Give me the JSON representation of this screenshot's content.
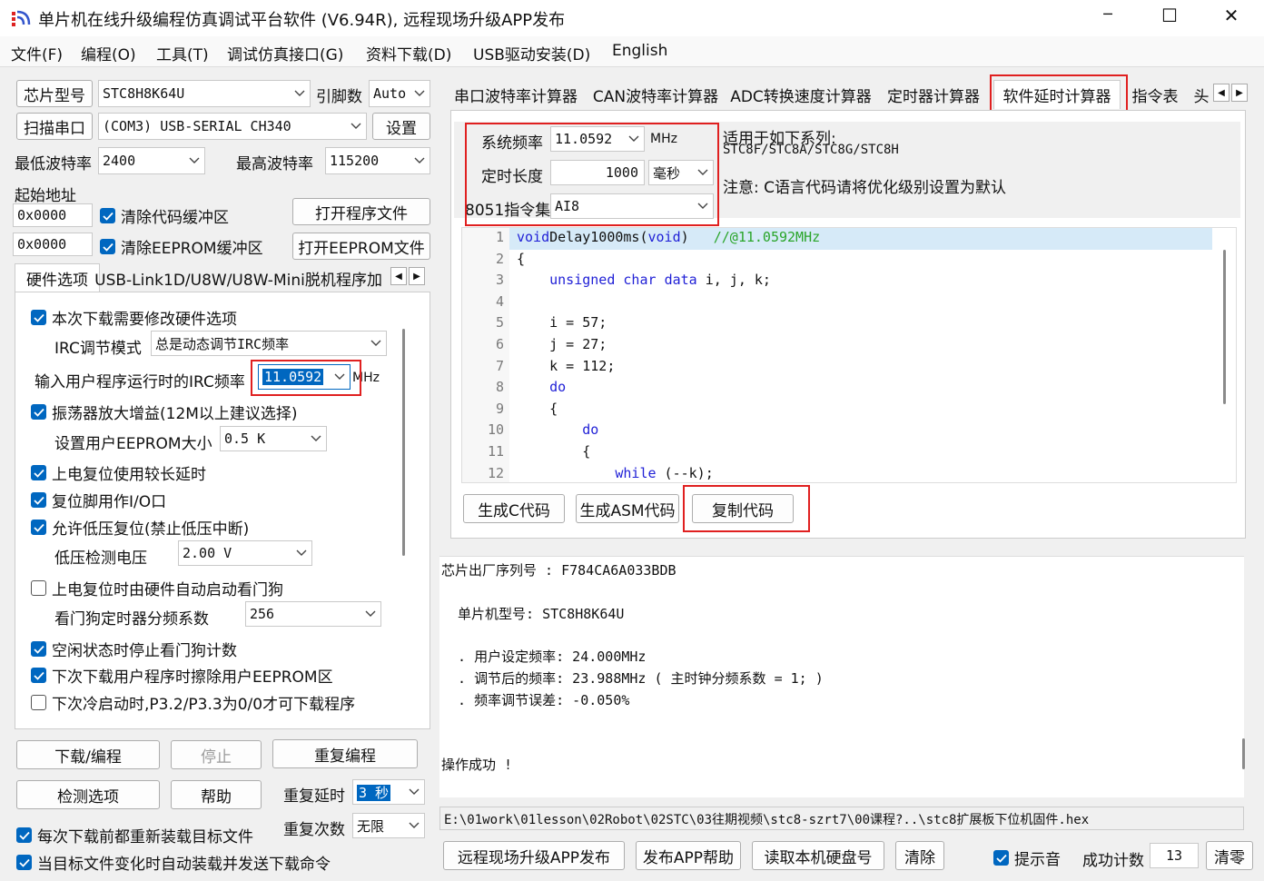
{
  "window": {
    "title": "单片机在线升级编程仿真调试平台软件 (V6.94R), 远程现场升级APP发布",
    "minimize": "─",
    "maximize": "☐",
    "close": "✕"
  },
  "menu": [
    "文件(F)",
    "编程(O)",
    "工具(T)",
    "调试仿真接口(G)",
    "资料下载(D)",
    "USB驱动安装(D)",
    "English"
  ],
  "left": {
    "chip_btn": "芯片型号",
    "chip_value": "STC8H8K64U",
    "pins_label": "引脚数",
    "pins_value": "Auto",
    "scan_btn": "扫描串口",
    "port_value": "(COM3) USB-SERIAL CH340",
    "settings_btn": "设置",
    "min_baud_label": "最低波特率",
    "min_baud_value": "2400",
    "max_baud_label": "最高波特率",
    "max_baud_value": "115200",
    "start_addr_label": "起始地址",
    "addr1": "0x0000",
    "clear_code": "清除代码缓冲区",
    "open_prog": "打开程序文件",
    "addr2": "0x0000",
    "clear_eeprom": "清除EEPROM缓冲区",
    "open_eeprom": "打开EEPROM文件",
    "tabs": [
      "硬件选项",
      "USB-Link1D/U8W/U8W-Mini脱机",
      "程序加"
    ],
    "opts": {
      "modify_hw": "本次下载需要修改硬件选项",
      "irc_mode_label": "IRC调节模式",
      "irc_mode_value": "总是动态调节IRC频率",
      "irc_freq_label": "输入用户程序运行时的IRC频率",
      "irc_freq_value": "11.0592",
      "irc_unit": "MHz",
      "osc_gain": "振荡器放大增益(12M以上建议选择)",
      "eeprom_size_label": "设置用户EEPROM大小",
      "eeprom_size_value": "0.5 K",
      "long_reset": "上电复位使用较长延时",
      "reset_io": "复位脚用作I/O口",
      "lvd_reset": "允许低压复位(禁止低压中断)",
      "lvd_voltage_label": "低压检测电压",
      "lvd_voltage_value": "2.00 V",
      "wdt_auto": "上电复位时由硬件自动启动看门狗",
      "wdt_div_label": "看门狗定时器分频系数",
      "wdt_div_value": "256",
      "idle_stop_wdt": "空闲状态时停止看门狗计数",
      "erase_eeprom": "下次下载用户程序时擦除用户EEPROM区",
      "cold_boot": "下次冷启动时,P3.2/P3.3为0/0才可下载程序"
    },
    "download_btn": "下载/编程",
    "stop_btn": "停止",
    "reprog_btn": "重复编程",
    "check_btn": "检测选项",
    "help_btn": "帮助",
    "repeat_delay_label": "重复延时",
    "repeat_delay_value": "3 秒",
    "repeat_count_label": "重复次数",
    "repeat_count_value": "无限",
    "reload_before": "每次下载前都重新装载目标文件",
    "auto_reload": "当目标文件变化时自动装载并发送下载命令"
  },
  "right": {
    "tabs": [
      "串口波特率计算器",
      "CAN波特率计算器",
      "ADC转换速度计算器",
      "定时器计算器",
      "软件延时计算器",
      "指令表",
      "头"
    ],
    "sys_freq_label": "系统频率",
    "sys_freq_value": "11.0592",
    "sys_freq_unit": "MHz",
    "delay_label": "定时长度",
    "delay_value": "1000",
    "delay_unit": "毫秒",
    "isa_label": "8051指令集",
    "isa_value": "AI8",
    "applies_label": "适用于如下系列:",
    "applies_series": "STC8F/STC8A/STC8G/STC8H",
    "note": "注意: C语言代码请将优化级别设置为默认",
    "code_lines": [
      {
        "n": "1",
        "t": [
          [
            "kw",
            "void"
          ],
          [
            "",
            "Delay1000ms("
          ],
          [
            "kw",
            "void"
          ],
          [
            "",
            ")\t"
          ],
          [
            "cm",
            "//@11.0592MHz"
          ]
        ]
      },
      {
        "n": "2",
        "t": [
          [
            "",
            "{"
          ]
        ]
      },
      {
        "n": "3",
        "t": [
          [
            "",
            "\t"
          ],
          [
            "kw",
            "unsigned"
          ],
          [
            "",
            " "
          ],
          [
            "kw",
            "char"
          ],
          [
            "",
            " "
          ],
          [
            "kw",
            "data"
          ],
          [
            "",
            " i, j, k;"
          ]
        ]
      },
      {
        "n": "4",
        "t": [
          [
            "",
            ""
          ]
        ]
      },
      {
        "n": "5",
        "t": [
          [
            "",
            "\ti = 57;"
          ]
        ]
      },
      {
        "n": "6",
        "t": [
          [
            "",
            "\tj = 27;"
          ]
        ]
      },
      {
        "n": "7",
        "t": [
          [
            "",
            "\tk = 112;"
          ]
        ]
      },
      {
        "n": "8",
        "t": [
          [
            "",
            "\t"
          ],
          [
            "kw",
            "do"
          ]
        ]
      },
      {
        "n": "9",
        "t": [
          [
            "",
            "\t{"
          ]
        ]
      },
      {
        "n": "10",
        "t": [
          [
            "",
            "\t\t"
          ],
          [
            "kw",
            "do"
          ]
        ]
      },
      {
        "n": "11",
        "t": [
          [
            "",
            "\t\t{"
          ]
        ]
      },
      {
        "n": "12",
        "t": [
          [
            "",
            "\t\t\t"
          ],
          [
            "kw",
            "while"
          ],
          [
            "",
            " (--k);"
          ]
        ]
      }
    ],
    "gen_c": "生成C代码",
    "gen_asm": "生成ASM代码",
    "copy_code": "复制代码",
    "output": [
      "芯片出厂序列号 : F784CA6A033BDB",
      "",
      "  单片机型号: STC8H8K64U",
      "",
      "  . 用户设定频率: 24.000MHz",
      "  . 调节后的频率: 23.988MHz ( 主时钟分频系数 = 1; )",
      "  . 频率调节误差: -0.050%",
      "",
      "",
      "操作成功 !"
    ],
    "file_path": "E:\\01work\\01lesson\\02Robot\\02STC\\03往期视频\\stc8-szrt7\\00课程?..\\stc8扩展板下位机固件.hex",
    "remote_btn": "远程现场升级APP发布",
    "publish_help": "发布APP帮助",
    "read_disk": "读取本机硬盘号",
    "clear_btn": "清除",
    "beep": "提示音",
    "success_label": "成功计数",
    "success_value": "13",
    "zero_btn": "清零"
  },
  "colors": {
    "accent": "#0067c0",
    "highlight": "#e02020",
    "keyword": "#1f1fd6",
    "comment": "#2aa52a"
  }
}
